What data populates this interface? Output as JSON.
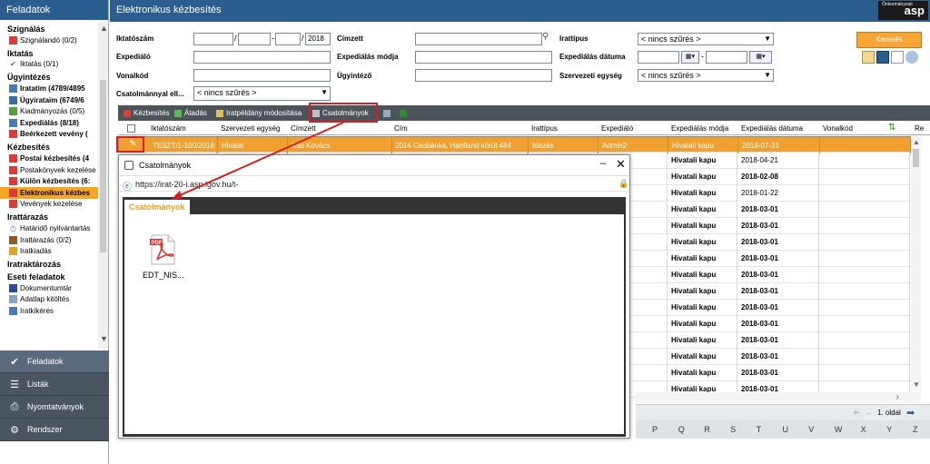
{
  "sidebar": {
    "title": "Feladatok",
    "sections": [
      {
        "title": "Szignálás",
        "items": [
          {
            "label": "Szignálandó (0/2)",
            "icon": "red-icon",
            "color": "#d93a3a"
          }
        ]
      },
      {
        "title": "Iktatás",
        "items": [
          {
            "label": "Iktatás (0/1)",
            "icon": "check-icon",
            "color": "#2a9a2a",
            "glyph": "✔"
          }
        ]
      },
      {
        "title": "Ügyintézés",
        "items": [
          {
            "label": "Iratatim (4789/4895",
            "icon": "doc-icon",
            "color": "#4a7ab0",
            "bold": true
          },
          {
            "label": "Ügyirataim (6749/6",
            "icon": "folder-icon",
            "color": "#3a6ea5",
            "bold": true
          },
          {
            "label": "Kiadmányozás (0/5)",
            "icon": "sign-icon",
            "color": "#5a9a3a"
          },
          {
            "label": "Expediálás (8/18)",
            "icon": "send-icon",
            "color": "#4a7ab0",
            "bold": true
          },
          {
            "label": "Beérkezett vevény (",
            "icon": "receipt-icon",
            "color": "#d93a3a",
            "bold": true
          }
        ]
      },
      {
        "title": "Kézbesítés",
        "items": [
          {
            "label": "Postai kézbesítés (4",
            "icon": "post-icon",
            "color": "#d93a3a",
            "bold": true
          },
          {
            "label": "Postakönyvek kezelése",
            "icon": "post-icon",
            "color": "#d93a3a"
          },
          {
            "label": "Külön kézbesítés (6:",
            "icon": "post-icon",
            "color": "#d93a3a",
            "bold": true
          },
          {
            "label": "Elektronikus kézbes",
            "icon": "post-icon",
            "color": "#d93a3a",
            "active": true
          },
          {
            "label": "Vevények kezelése",
            "icon": "post-icon",
            "color": "#d93a3a"
          }
        ]
      },
      {
        "title": "Irattárazás",
        "items": [
          {
            "label": "Határidő nyilvántartás",
            "icon": "clock-icon",
            "color": "#4a7ab0",
            "glyph": "◷"
          },
          {
            "label": "Irattárazás (0/2)",
            "icon": "archive-icon",
            "color": "#8a5a2a"
          },
          {
            "label": "Iratkiadás",
            "icon": "archive-icon",
            "color": "#d9a62a"
          }
        ]
      },
      {
        "title": "Iratraktározás",
        "items": []
      },
      {
        "title": "Eseti feladatok",
        "items": [
          {
            "label": "Dokumentumtár",
            "icon": "word-icon",
            "color": "#2a4a9a"
          },
          {
            "label": "Adatlap kitöltés",
            "icon": "form-icon",
            "color": "#8aa0c0"
          },
          {
            "label": "Iratkikérés",
            "icon": "request-icon",
            "color": "#4a7ab0"
          }
        ]
      }
    ],
    "nav": [
      {
        "label": "Feladatok",
        "icon": "check-icon",
        "glyph": "✔",
        "active": true
      },
      {
        "label": "Listák",
        "icon": "list-icon",
        "glyph": "☰"
      },
      {
        "label": "Nyomtatványok",
        "icon": "print-icon",
        "glyph": "⎙"
      },
      {
        "label": "Rendszer",
        "icon": "gear-icon",
        "glyph": "⚙"
      }
    ]
  },
  "header": {
    "title": "Elektronikus kézbesítés",
    "logo_text": "asp",
    "logo_small": "Önkormányzati"
  },
  "filter": {
    "iktatoszam_label": "Iktatószám",
    "year": "2018",
    "cimzett_label": "Címzett",
    "irattipus_label": "Irattípus",
    "irattipus_value": "< nincs szűrés >",
    "expedialo_label": "Expediáló",
    "expedialas_modja_label": "Expediálás módja",
    "expedialas_datuma_label": "Expediálás dátuma",
    "vonalkod_label": "Vonalkód",
    "ugyintezo_label": "Ügyintéző",
    "szervezeti_egyseg_label": "Szervezeti egység",
    "szervezeti_egyseg_value": "< nincs szűrés >",
    "csatolmany_label": "Csatolmánnyal ell...",
    "csatolmany_value": "< nincs szűrés >",
    "search_button": "Keresés"
  },
  "toolbar": {
    "kezbesites": "Kézbesítés",
    "atadas": "Átadás",
    "iratpeldany": "Iratpéldány módosítása",
    "csatolmanyok": "Csatolmányok"
  },
  "table": {
    "columns": [
      "Iktatószám",
      "Szervezeti egység",
      "Címzett",
      "Cím",
      "Irattípus",
      "Expediáló",
      "Expediálás módja",
      "Expediálás dátuma",
      "Vonalkód",
      "Re"
    ],
    "rows": [
      {
        "iktatoszam": "TESZT/1-100/2018",
        "szervezeti": "Hivatal",
        "cimzett": "Kati Kovács",
        "cim": "2014 Csobánka, Hanfland körút 484",
        "irattipus": "Idézés",
        "expedialo": "Admin2",
        "mod": "Hivatali kapu",
        "datum": "2018-07-31",
        "selected": true,
        "bold": false
      },
      {
        "mod": "Hivatali kapu",
        "datum": "2018-04-21",
        "bold": false
      },
      {
        "mod": "Hivatali kapu",
        "datum": "2018-02-08",
        "bold": true
      },
      {
        "mod": "Hivatali kapu",
        "datum": "2018-01-22",
        "bold": false
      },
      {
        "mod": "Hivatali kapu",
        "datum": "2018-03-01",
        "bold": true
      },
      {
        "mod": "Hivatali kapu",
        "datum": "2018-03-01",
        "bold": true
      },
      {
        "mod": "Hivatali kapu",
        "datum": "2018-03-01",
        "bold": true
      },
      {
        "mod": "Hivatali kapu",
        "datum": "2018-03-01",
        "bold": true
      },
      {
        "mod": "Hivatali kapu",
        "datum": "2018-03-01",
        "bold": true
      },
      {
        "mod": "Hivatali kapu",
        "datum": "2018-03-01",
        "bold": true
      },
      {
        "mod": "Hivatali kapu",
        "datum": "2018-03-01",
        "bold": true
      },
      {
        "mod": "Hivatali kapu",
        "datum": "2018-03-01",
        "bold": true
      },
      {
        "mod": "Hivatali kapu",
        "datum": "2018-03-01",
        "bold": true
      },
      {
        "mod": "Hivatali kapu",
        "datum": "2018-03-01",
        "bold": true
      },
      {
        "mod": "Hivatali kapu",
        "datum": "2018-03-01",
        "bold": true
      },
      {
        "mod": "Hivatali kapu",
        "datum": "2018-03-01",
        "bold": true
      }
    ]
  },
  "pager": {
    "page_label": "1. oldal"
  },
  "alphabet": [
    "P",
    "Q",
    "R",
    "S",
    "T",
    "U",
    "V",
    "W",
    "X",
    "Y",
    "Z"
  ],
  "modal": {
    "title": "Csatolmányok",
    "url": "https://irat-20-i.asp.lgov.hu/t-",
    "tab": "Csatolmányok",
    "file_name": "EDT_NIS...",
    "pdf_label": "PDF"
  },
  "colors": {
    "header": "#2c5d8f",
    "accent": "#f5a623",
    "highlight": "#d42020"
  }
}
